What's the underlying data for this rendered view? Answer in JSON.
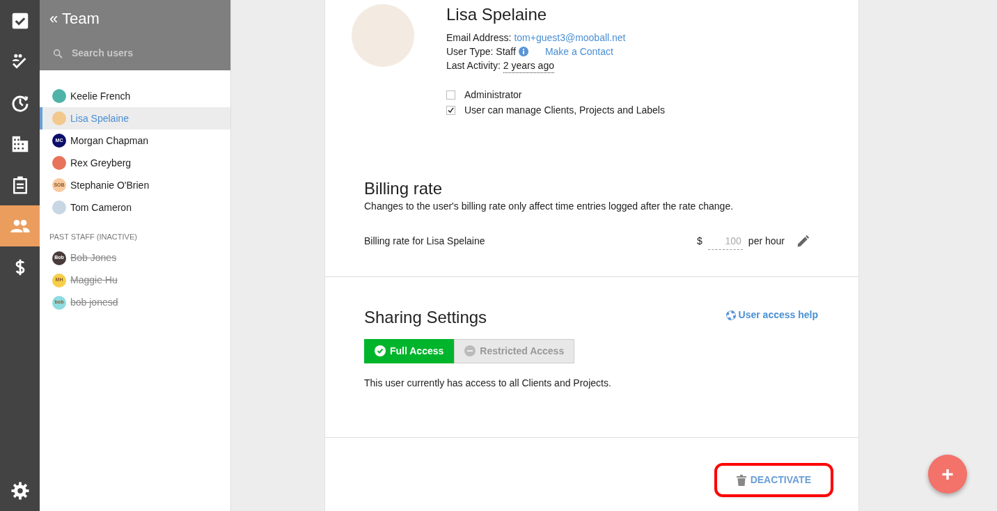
{
  "rail": [
    {
      "selected": false
    },
    {
      "selected": false
    },
    {
      "selected": false
    },
    {
      "selected": false
    },
    {
      "selected": false
    },
    {
      "selected": true
    },
    {
      "selected": false
    },
    {
      "selected": false
    }
  ],
  "sidebar": {
    "title": "« Team",
    "search": {
      "placeholder": "Search users"
    },
    "users": [
      {
        "name": "Keelie French",
        "selected": false,
        "color": "#4fb3a9"
      },
      {
        "name": "Lisa Spelaine",
        "selected": true,
        "color": "#f2c88c"
      },
      {
        "name": "Morgan Chapman",
        "selected": false,
        "color": "#0d0d6b",
        "initials": "MC"
      },
      {
        "name": "Rex Greyberg",
        "selected": false,
        "color": "#e8735a"
      },
      {
        "name": "Stephanie O'Brien",
        "selected": false,
        "color": "#f9c9a0",
        "initials": "SOB"
      },
      {
        "name": "Tom Cameron",
        "selected": false,
        "color": "#c9d6e3"
      }
    ],
    "past_heading": "PAST STAFF (INACTIVE)",
    "past_users": [
      {
        "name": "Bob Jones",
        "color": "#4a3b3b",
        "initials": "Bob"
      },
      {
        "name": "Maggie Hu",
        "color": "#f7cf4a",
        "initials": "MH"
      },
      {
        "name": "bob jonesd",
        "color": "#8fdbe0",
        "initials": "bob"
      }
    ]
  },
  "profile": {
    "name": "Lisa Spelaine",
    "email_label": "Email Address:",
    "email": "tom+guest3@mooball.net",
    "type_label": "User Type: Staff",
    "make_contact": "Make a Contact",
    "activity_label": "Last Activity:",
    "activity": "2 years ago",
    "checkboxes": [
      {
        "label": "Administrator",
        "checked": false
      },
      {
        "label": "User can manage Clients, Projects and Labels",
        "checked": true
      }
    ]
  },
  "billing": {
    "title": "Billing rate",
    "note": "Changes to the user's billing rate only affect time entries logged after the rate change.",
    "label": "Billing rate for Lisa Spelaine",
    "currency": "$",
    "placeholder": "100",
    "unit": "per hour"
  },
  "sharing": {
    "title": "Sharing Settings",
    "help": "User access help",
    "options": [
      {
        "label": "Full Access",
        "selected": true
      },
      {
        "label": "Restricted Access",
        "selected": false
      }
    ],
    "note": "This user currently has access to all Clients and Projects."
  },
  "deactivate": {
    "label": "DEACTIVATE",
    "highlighted": true
  },
  "fab": {
    "label": "+"
  }
}
